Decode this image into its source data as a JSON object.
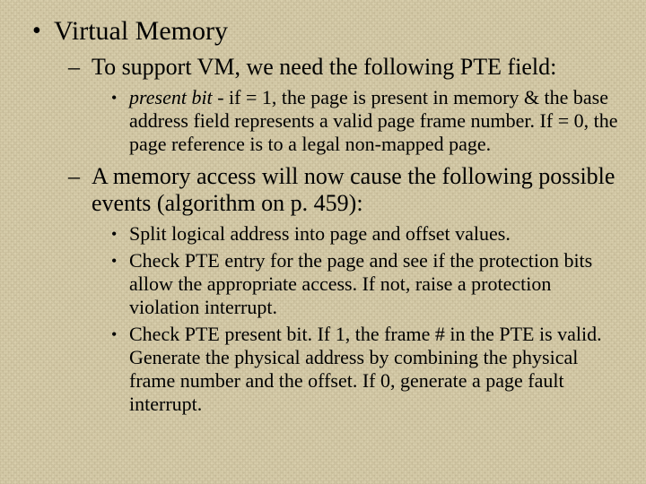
{
  "slide": {
    "title": "Virtual Memory",
    "sec1": {
      "heading": "To support VM, we need the following PTE field:",
      "item1_emph": "present bit",
      "item1_rest": " - if = 1, the page is present in memory & the base address field represents a valid page frame number.  If = 0, the page reference is to a legal non-mapped page."
    },
    "sec2": {
      "heading": "A memory access will now cause the following possible events (algorithm on p. 459):",
      "item1": "Split logical address into page and offset values.",
      "item2": "Check PTE entry for the page and see if the protection bits allow the appropriate access.  If not, raise a protection violation interrupt.",
      "item3": "Check PTE present bit.  If 1, the frame # in the PTE is valid.  Generate the physical address by combining the physical frame number and the offset.  If 0, generate a page fault interrupt."
    }
  }
}
